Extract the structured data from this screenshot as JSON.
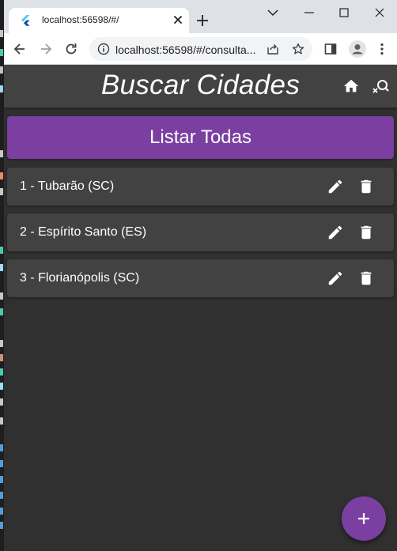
{
  "browser": {
    "tab_title": "localhost:56598/#/",
    "url": "localhost:56598/#/consulta...",
    "icons": {
      "favicon": "flutter-icon",
      "tab_close": "close-icon",
      "new_tab": "plus-icon",
      "minimize": "minimize-icon",
      "maximize": "maximize-icon",
      "window_close": "close-icon",
      "tab_list": "chevron-down-icon",
      "back": "arrow-left-icon",
      "forward": "arrow-right-icon",
      "reload": "reload-icon",
      "site_info": "info-icon",
      "share": "share-icon",
      "bookmark": "star-icon",
      "side_panel": "side-panel-icon",
      "profile": "avatar-icon",
      "menu": "kebab-menu-icon"
    }
  },
  "app": {
    "title": "Buscar Cidades",
    "icons": {
      "home": "home-icon",
      "search": "search-off-icon"
    },
    "list_all_label": "Listar Todas",
    "cities": [
      {
        "label": "1 - Tubarão (SC)"
      },
      {
        "label": "2 - Espírito Santo (ES)"
      },
      {
        "label": "3 - Florianópolis (SC)"
      }
    ],
    "row_icons": {
      "edit": "pencil-icon",
      "delete": "trash-icon"
    },
    "fab_icon": "plus-icon",
    "colors": {
      "accent": "#7a3fa0",
      "appbar": "#424242",
      "background": "#303030",
      "card": "#424242",
      "text": "#ffffff"
    }
  }
}
